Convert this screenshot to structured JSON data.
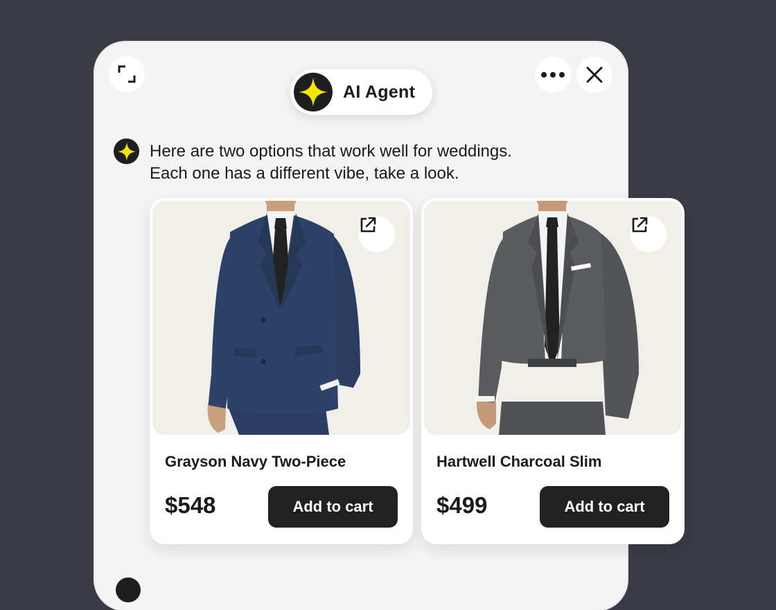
{
  "app": {
    "title": "AI Agent",
    "accent_color": "#f2e600",
    "icons": {
      "expand": "expand-icon",
      "more": "more-horizontal-icon",
      "close": "close-icon",
      "logo": "sparkle-icon",
      "external": "external-link-icon"
    }
  },
  "message": {
    "lines": [
      "Here are two options that work well for weddings.",
      "Each one has a different vibe, take a look."
    ]
  },
  "products": [
    {
      "name": "Grayson Navy Two-Piece",
      "price": "$548",
      "button_label": "Add to cart",
      "suit_color": "#2e4268"
    },
    {
      "name": "Hartwell Charcoal Slim",
      "price": "$499",
      "button_label": "Add to cart",
      "suit_color": "#55575a"
    }
  ]
}
